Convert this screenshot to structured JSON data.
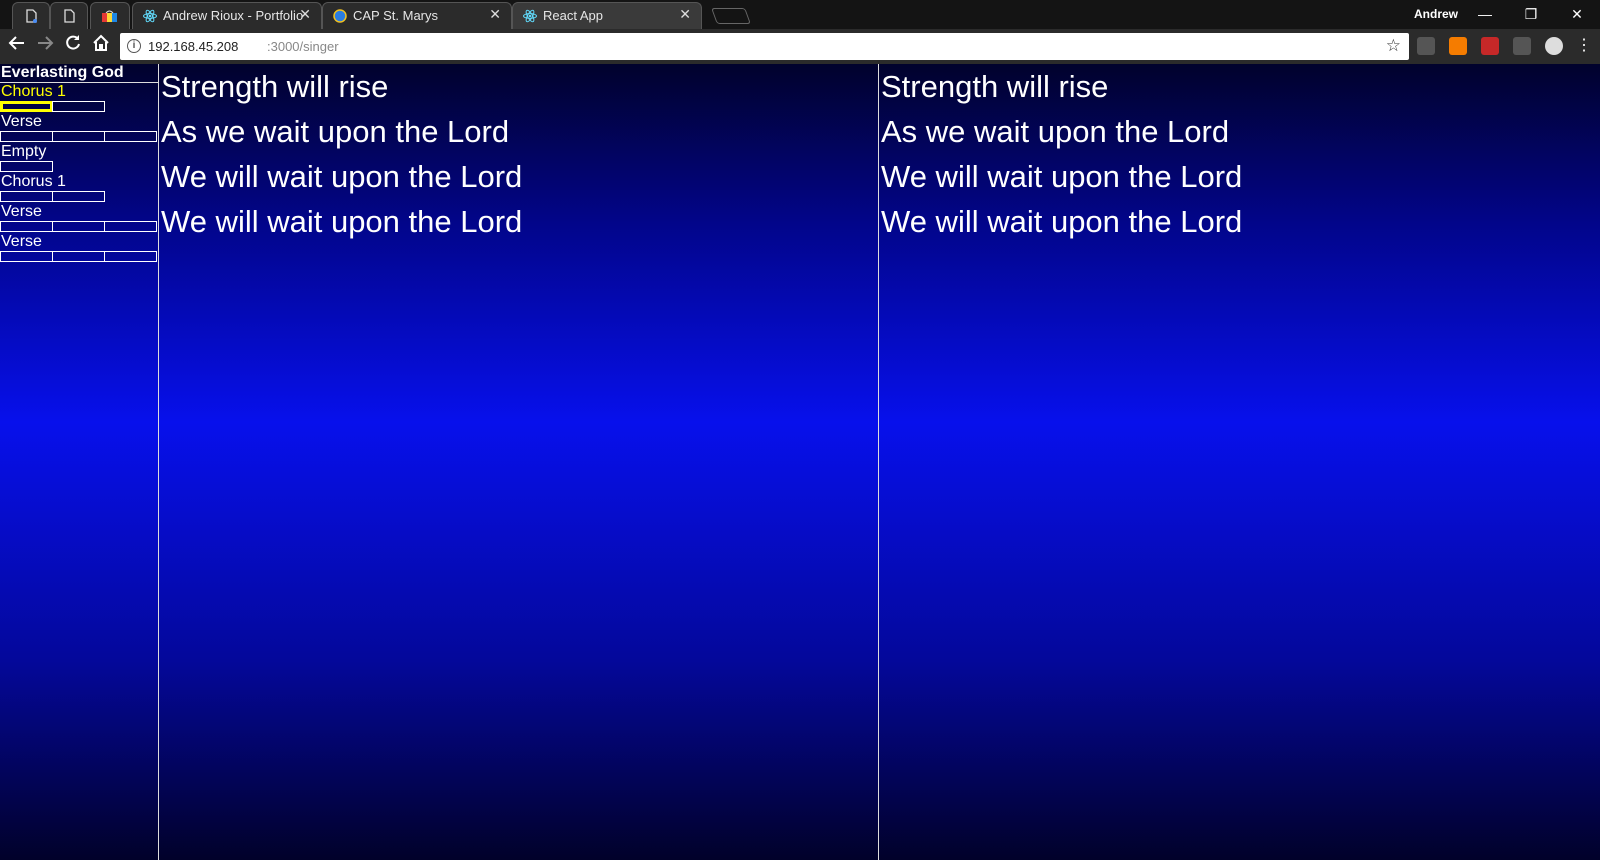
{
  "browser": {
    "tabs": [
      {
        "title": "",
        "icon": "file-icon"
      },
      {
        "title": "",
        "icon": "file-icon"
      },
      {
        "title": "",
        "icon": "colorful-app-icon"
      },
      {
        "title": "Andrew Rioux - Portfolio",
        "icon": "react-icon"
      },
      {
        "title": "CAP St. Marys",
        "icon": "globe-icon"
      },
      {
        "title": "React App",
        "icon": "react-icon"
      }
    ],
    "profile_name": "Andrew",
    "window_controls": {
      "minimize": "—",
      "restore": "❐",
      "close": "✕"
    },
    "url_host": "192.168.45.208",
    "url_path": ":3000/singer",
    "accent_colors": {
      "highlight": "#ffff00",
      "background_blue": "#0710ec"
    }
  },
  "sidebar": {
    "song_title": "Everlasting God",
    "sections": [
      {
        "label": "Chorus 1",
        "current": true,
        "slides": 2,
        "active_slide": 1
      },
      {
        "label": "Verse",
        "current": false,
        "slides": 3,
        "active_slide": 0
      },
      {
        "label": "Empty",
        "current": false,
        "slides": 1,
        "active_slide": 0
      },
      {
        "label": "Chorus 1",
        "current": false,
        "slides": 2,
        "active_slide": 0
      },
      {
        "label": "Verse",
        "current": false,
        "slides": 3,
        "active_slide": 0
      },
      {
        "label": "Verse",
        "current": false,
        "slides": 3,
        "active_slide": 0
      }
    ]
  },
  "current_lyrics": [
    "Strength will rise",
    "As we wait upon the Lord",
    "We will wait upon the Lord",
    "We will wait upon the Lord"
  ],
  "next_lyrics": [
    "Strength will rise",
    "As we wait upon the Lord",
    "We will wait upon the Lord",
    "We will wait upon the Lord"
  ]
}
